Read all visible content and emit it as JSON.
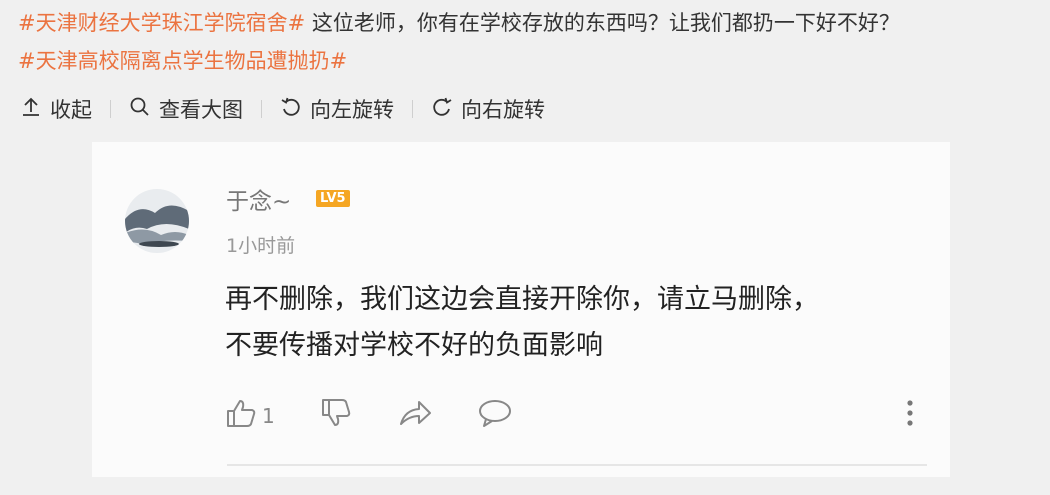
{
  "post": {
    "topic1": "#天津财经大学珠江学院宿舍#",
    "body": " 这位老师，你有在学校存放的东西吗？让我们都扔一下好不好？",
    "topic2": "#天津高校隔离点学生物品遭抛扔#"
  },
  "toolbar": {
    "collapse": "收起",
    "view_large": "查看大图",
    "rotate_left": "向左旋转",
    "rotate_right": "向右旋转"
  },
  "comment": {
    "username": "于念~",
    "level": "LV5",
    "time": "1小时前",
    "text_line1": "再不删除，我们这边会直接开除你，请立马删除，",
    "text_line2": "不要传播对学校不好的负面影响",
    "like_count": "1"
  },
  "colors": {
    "topic": "#eb7340",
    "level_badge": "#f5a623",
    "background": "#f0f0f0",
    "card": "#fbfbfb"
  },
  "icons": [
    "upload-icon",
    "search-icon",
    "rotate-left-icon",
    "rotate-right-icon",
    "thumbs-up-icon",
    "thumbs-down-icon",
    "share-icon",
    "comment-icon",
    "more-icon"
  ]
}
